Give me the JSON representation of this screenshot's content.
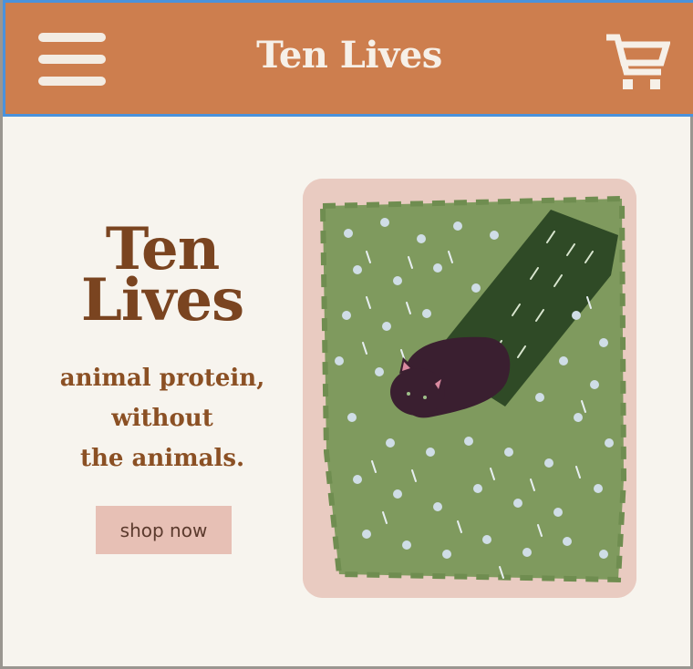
{
  "header": {
    "brand": "Ten Lives",
    "menu_icon": "hamburger-menu-icon",
    "cart_icon": "shopping-cart-icon"
  },
  "hero": {
    "title_line1": "Ten",
    "title_line2": "Lives",
    "tagline_line1": "animal protein,",
    "tagline_line2": "without",
    "tagline_line3": "the animals.",
    "cta_label": "shop now",
    "image_subject": "black cat lying in a field of white flowers"
  },
  "colors": {
    "header_bg": "#cd7e4e",
    "page_bg": "#f7f4ee",
    "title_text": "#7a4420",
    "cta_bg": "#e7c0b5",
    "grass": "#7f9a5e"
  }
}
